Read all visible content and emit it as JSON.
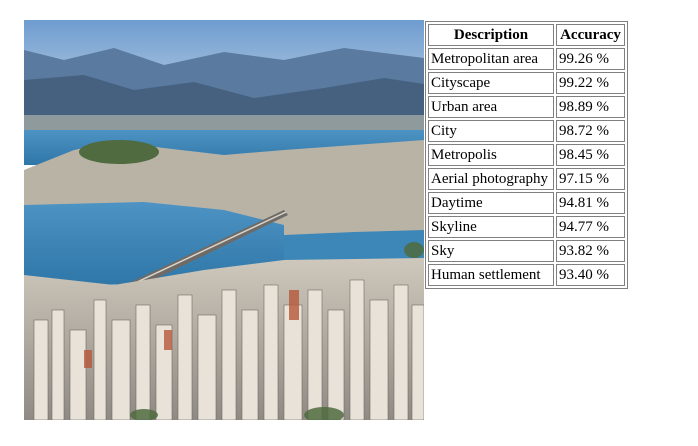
{
  "image": {
    "alt": "Aerial view of a coastal city with a bridge over the bay",
    "colors": {
      "sky": "#7aa3cc",
      "mountains": "#4b6a8f",
      "water": "#3c86b8",
      "buildings": "#c9c3b8",
      "vegetation": "#4f6b3f"
    }
  },
  "table": {
    "headers": {
      "description": "Description",
      "accuracy": "Accuracy"
    },
    "rows": [
      {
        "description": "Metropolitan area",
        "accuracy": "99.26 %"
      },
      {
        "description": "Cityscape",
        "accuracy": "99.22 %"
      },
      {
        "description": "Urban area",
        "accuracy": "98.89 %"
      },
      {
        "description": "City",
        "accuracy": "98.72 %"
      },
      {
        "description": "Metropolis",
        "accuracy": "98.45 %"
      },
      {
        "description": "Aerial photography",
        "accuracy": "97.15 %"
      },
      {
        "description": "Daytime",
        "accuracy": "94.81 %"
      },
      {
        "description": "Skyline",
        "accuracy": "94.77 %"
      },
      {
        "description": "Sky",
        "accuracy": "93.82 %"
      },
      {
        "description": "Human settlement",
        "accuracy": "93.40 %"
      }
    ]
  }
}
